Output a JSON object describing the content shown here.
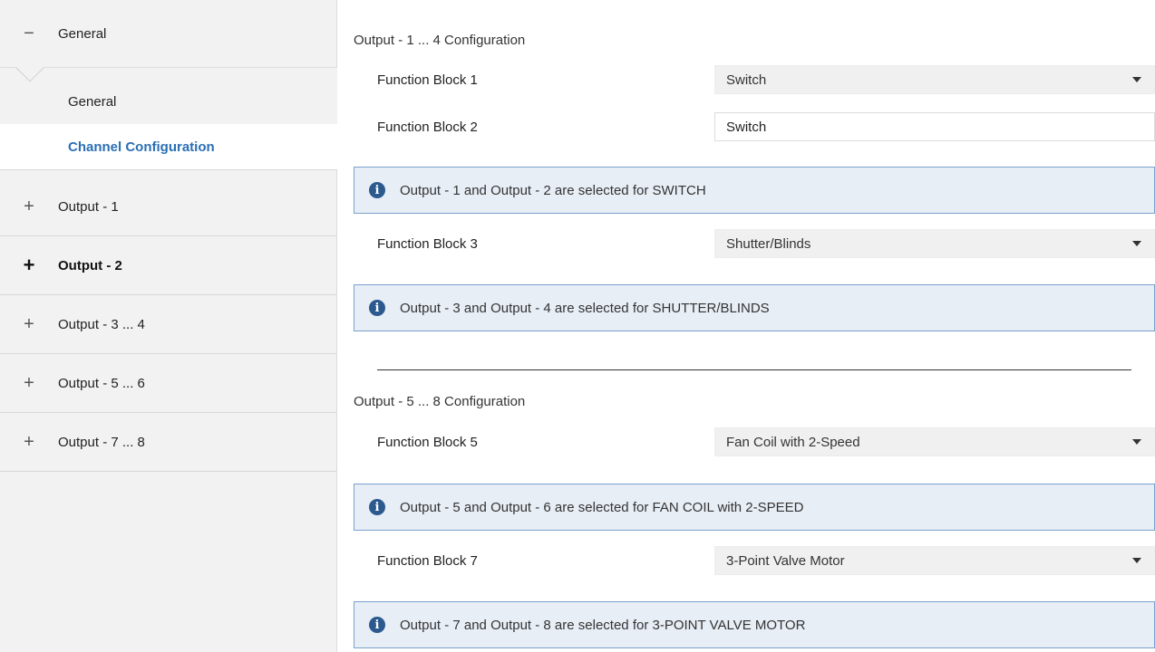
{
  "sidebar": {
    "general": {
      "sign": "−",
      "label": "General"
    },
    "sub_items": [
      {
        "label": "General"
      },
      {
        "label": "Channel Configuration"
      }
    ],
    "groups": [
      {
        "sign": "+",
        "label": "Output - 1"
      },
      {
        "sign": "+",
        "label": "Output - 2"
      },
      {
        "sign": "+",
        "label": "Output - 3 ... 4"
      },
      {
        "sign": "+",
        "label": "Output - 5 ... 6"
      },
      {
        "sign": "+",
        "label": "Output - 7 ... 8"
      }
    ]
  },
  "main": {
    "section1_title": "Output - 1 ... 4 Configuration",
    "fb1": {
      "label": "Function Block 1",
      "value": "Switch"
    },
    "fb2": {
      "label": "Function Block 2",
      "value": "Switch"
    },
    "info1": "Output - 1 and Output - 2 are selected for SWITCH",
    "fb3": {
      "label": "Function Block 3",
      "value": "Shutter/Blinds"
    },
    "info2": "Output - 3 and Output - 4 are selected for SHUTTER/BLINDS",
    "section2_title": "Output - 5 ... 8 Configuration",
    "fb5": {
      "label": "Function Block 5",
      "value": "Fan Coil with 2-Speed"
    },
    "info3": "Output - 5 and Output - 6 are selected for FAN COIL with 2-SPEED",
    "fb7": {
      "label": "Function Block 7",
      "value": "3-Point Valve Motor"
    },
    "info4": "Output - 7 and Output - 8 are selected for 3-POINT VALVE MOTOR",
    "info_icon_glyph": "i"
  },
  "colors": {
    "accent": "#2a6fb5",
    "info_bg": "#e8eef6",
    "info_border": "#7aa0cd",
    "info_icon": "#2c5a8f"
  }
}
